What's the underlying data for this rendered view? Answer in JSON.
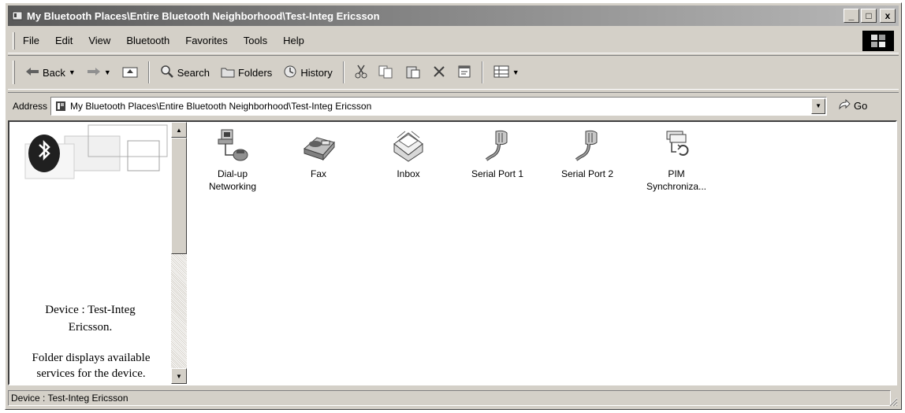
{
  "window": {
    "title": "My Bluetooth Places\\Entire Bluetooth Neighborhood\\Test-Integ Ericsson",
    "minimize": "_",
    "maximize": "□",
    "close": "x"
  },
  "menubar": {
    "items": [
      "File",
      "Edit",
      "View",
      "Bluetooth",
      "Favorites",
      "Tools",
      "Help"
    ]
  },
  "toolbar": {
    "back": "Back",
    "search": "Search",
    "folders": "Folders",
    "history": "History"
  },
  "address": {
    "label": "Address",
    "value": "My Bluetooth Places\\Entire Bluetooth Neighborhood\\Test-Integ Ericsson",
    "go": "Go"
  },
  "left_pane": {
    "device_line1": "Device : Test-Integ",
    "device_line2": "Ericsson.",
    "desc_line1": "Folder displays available",
    "desc_line2": "services for the device."
  },
  "services": [
    {
      "label": "Dial-up Networking",
      "icon": "dialup-networking-icon"
    },
    {
      "label": "Fax",
      "icon": "fax-icon"
    },
    {
      "label": "Inbox",
      "icon": "inbox-icon"
    },
    {
      "label": "Serial Port 1",
      "icon": "serial-port-icon"
    },
    {
      "label": "Serial Port 2",
      "icon": "serial-port-icon"
    },
    {
      "label": "PIM Synchroniza...",
      "icon": "pim-sync-icon"
    }
  ],
  "statusbar": {
    "text": "Device : Test-Integ Ericsson"
  }
}
